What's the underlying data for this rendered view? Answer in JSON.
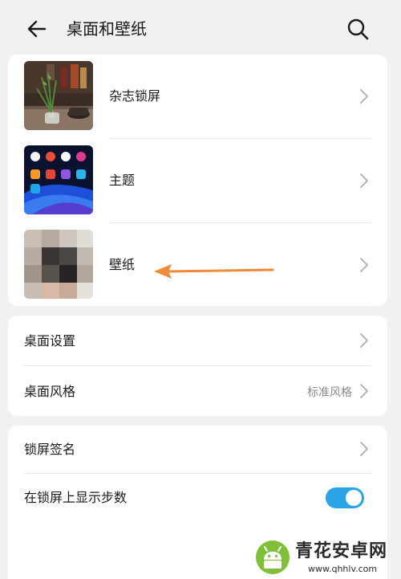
{
  "header": {
    "title": "桌面和壁纸",
    "back_icon": "back-arrow-icon",
    "search_icon": "search-icon"
  },
  "theme_section": {
    "items": [
      {
        "label": "杂志锁屏",
        "thumbnail": "magazine-lockscreen-thumbnail"
      },
      {
        "label": "主题",
        "thumbnail": "theme-thumbnail"
      },
      {
        "label": "壁纸",
        "thumbnail": "wallpaper-thumbnail"
      }
    ]
  },
  "home_section": {
    "items": [
      {
        "label": "桌面设置",
        "value": ""
      },
      {
        "label": "桌面风格",
        "value": "标准风格"
      }
    ]
  },
  "lock_section": {
    "items": [
      {
        "label": "锁屏签名"
      },
      {
        "label": "在锁屏上显示步数",
        "toggle_on": true
      }
    ]
  },
  "annotation": {
    "arrow_color": "#f08a3a"
  },
  "watermark": {
    "title": "青花安卓网",
    "url": "www.qhhlv.com"
  },
  "colors": {
    "accent": "#2aa3e6",
    "background": "#f1f1f1",
    "card": "#ffffff"
  }
}
